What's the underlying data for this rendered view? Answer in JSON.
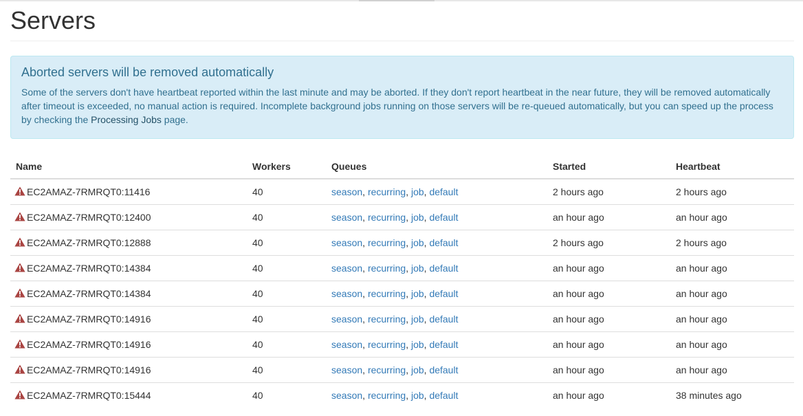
{
  "page": {
    "title": "Servers"
  },
  "alert": {
    "heading": "Aborted servers will be removed automatically",
    "text_before": "Some of the servers don't have heartbeat reported within the last minute and may be aborted. If they don't report heartbeat in the near future, they will be removed automatically after timeout is exceeded, no manual action is required. Incomplete background jobs running on those servers will be re-queued automatically, but you can speed up the process by checking the ",
    "link_label": "Processing Jobs",
    "text_after": " page."
  },
  "table": {
    "columns": [
      "Name",
      "Workers",
      "Queues",
      "Started",
      "Heartbeat"
    ],
    "queues": [
      "season",
      "recurring",
      "job",
      "default"
    ],
    "rows": [
      {
        "name": "EC2AMAZ-7RMRQT0:11416",
        "workers": "40",
        "started": "2 hours ago",
        "heartbeat": "2 hours ago"
      },
      {
        "name": "EC2AMAZ-7RMRQT0:12400",
        "workers": "40",
        "started": "an hour ago",
        "heartbeat": "an hour ago"
      },
      {
        "name": "EC2AMAZ-7RMRQT0:12888",
        "workers": "40",
        "started": "2 hours ago",
        "heartbeat": "2 hours ago"
      },
      {
        "name": "EC2AMAZ-7RMRQT0:14384",
        "workers": "40",
        "started": "an hour ago",
        "heartbeat": "an hour ago"
      },
      {
        "name": "EC2AMAZ-7RMRQT0:14384",
        "workers": "40",
        "started": "an hour ago",
        "heartbeat": "an hour ago"
      },
      {
        "name": "EC2AMAZ-7RMRQT0:14916",
        "workers": "40",
        "started": "an hour ago",
        "heartbeat": "an hour ago"
      },
      {
        "name": "EC2AMAZ-7RMRQT0:14916",
        "workers": "40",
        "started": "an hour ago",
        "heartbeat": "an hour ago"
      },
      {
        "name": "EC2AMAZ-7RMRQT0:14916",
        "workers": "40",
        "started": "an hour ago",
        "heartbeat": "an hour ago"
      },
      {
        "name": "EC2AMAZ-7RMRQT0:15444",
        "workers": "40",
        "started": "an hour ago",
        "heartbeat": "38 minutes ago"
      }
    ]
  },
  "icons": {
    "row_status": "warning-triangle-icon"
  },
  "colors": {
    "alert_bg": "#d9edf7",
    "alert_text": "#31708f",
    "link": "#337ab7",
    "warning": "#a94442"
  }
}
